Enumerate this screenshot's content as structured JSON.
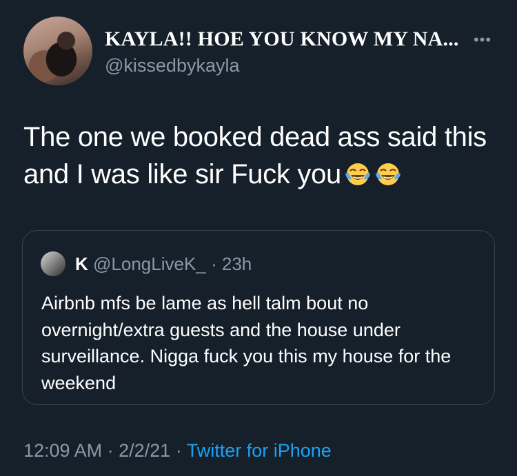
{
  "author": {
    "display_name": "KAYLA!! HOE YOU KNOW MY NA...",
    "handle": "@kissedbykayla"
  },
  "tweet": {
    "text": "The one we booked dead ass said this and I was like sir Fuck you",
    "emojis": [
      "face-with-tears-of-joy-icon",
      "face-with-tears-of-joy-icon"
    ]
  },
  "quoted_tweet": {
    "name": "K",
    "handle": "@LongLiveK_",
    "separator": "·",
    "time": "23h",
    "text": "Airbnb mfs be lame as hell talm bout no overnight/extra guests and the house under surveillance. Nigga fuck you this my house for the weekend"
  },
  "footer": {
    "time": "12:09 AM",
    "separator": "·",
    "date": "2/2/21",
    "separator2": "·",
    "source": "Twitter for iPhone"
  },
  "colors": {
    "background": "#15202b",
    "text": "#ffffff",
    "secondary": "#8899a6",
    "link": "#1da1f2",
    "border": "#38444d"
  },
  "icons": {
    "more": "more-options-icon"
  }
}
